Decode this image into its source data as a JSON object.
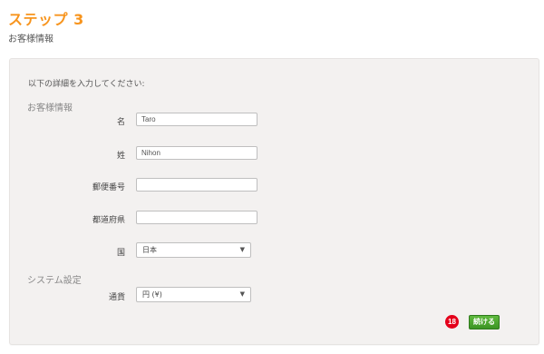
{
  "header": {
    "title": "ステップ 3",
    "subtitle": "お客様情報"
  },
  "form": {
    "intro": "以下の詳細を入力してください:",
    "customer_section": "お客様情報",
    "first_name": {
      "label": "名",
      "value": "Taro"
    },
    "last_name": {
      "label": "姓",
      "value": "Nihon"
    },
    "postal_code": {
      "label": "郵便番号",
      "value": ""
    },
    "prefecture": {
      "label": "都道府県",
      "value": ""
    },
    "country": {
      "label": "国",
      "selected": "日本"
    },
    "system_section": "システム設定",
    "currency": {
      "label": "通貨",
      "selected": "円 (¥)"
    },
    "marker": "18",
    "continue_label": "続ける"
  },
  "colors": {
    "accent": "#f7941d",
    "button": "#4ca52f",
    "marker": "#e4001b"
  }
}
